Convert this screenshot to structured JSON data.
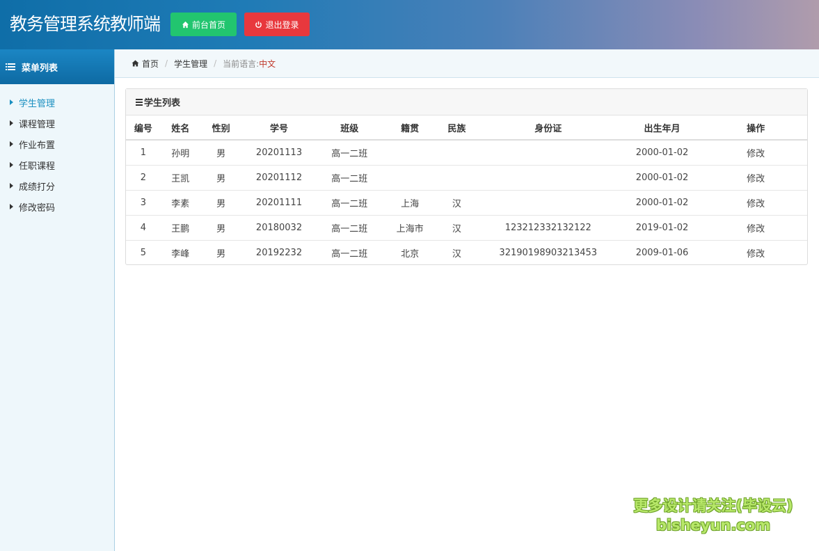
{
  "header": {
    "title": "教务管理系统教师端",
    "home_button": "前台首页",
    "logout_button": "退出登录",
    "home_button_color": "#22c56f",
    "logout_button_color": "#e8383d"
  },
  "sidebar": {
    "title": "菜单列表",
    "items": [
      {
        "label": "学生管理",
        "active": true
      },
      {
        "label": "课程管理",
        "active": false
      },
      {
        "label": "作业布置",
        "active": false
      },
      {
        "label": "任职课程",
        "active": false
      },
      {
        "label": "成绩打分",
        "active": false
      },
      {
        "label": "修改密码",
        "active": false
      }
    ]
  },
  "breadcrumb": {
    "home": "首页",
    "current": "学生管理",
    "lang_label": "当前语言:",
    "lang_value": "中文"
  },
  "panel": {
    "title": "学生列表",
    "columns": [
      "编号",
      "姓名",
      "性别",
      "学号",
      "班级",
      "籍贯",
      "民族",
      "身份证",
      "出生年月",
      "操作"
    ],
    "rows": [
      [
        "1",
        "孙明",
        "男",
        "20201113",
        "高一二班",
        "",
        "",
        "",
        "2000-01-02",
        "修改"
      ],
      [
        "2",
        "王凯",
        "男",
        "20201112",
        "高一二班",
        "",
        "",
        "",
        "2000-01-02",
        "修改"
      ],
      [
        "3",
        "李素",
        "男",
        "20201111",
        "高一二班",
        "上海",
        "汉",
        "",
        "2000-01-02",
        "修改"
      ],
      [
        "4",
        "王鹏",
        "男",
        "20180032",
        "高一二班",
        "上海市",
        "汉",
        "123212332132122",
        "2019-01-02",
        "修改"
      ],
      [
        "5",
        "李峰",
        "男",
        "20192232",
        "高一二班",
        "北京",
        "汉",
        "32190198903213453",
        "2009-01-06",
        "修改"
      ]
    ]
  },
  "watermark": {
    "line1": "更多设计请关注(毕设云)",
    "line2": "bisheyun.com"
  }
}
